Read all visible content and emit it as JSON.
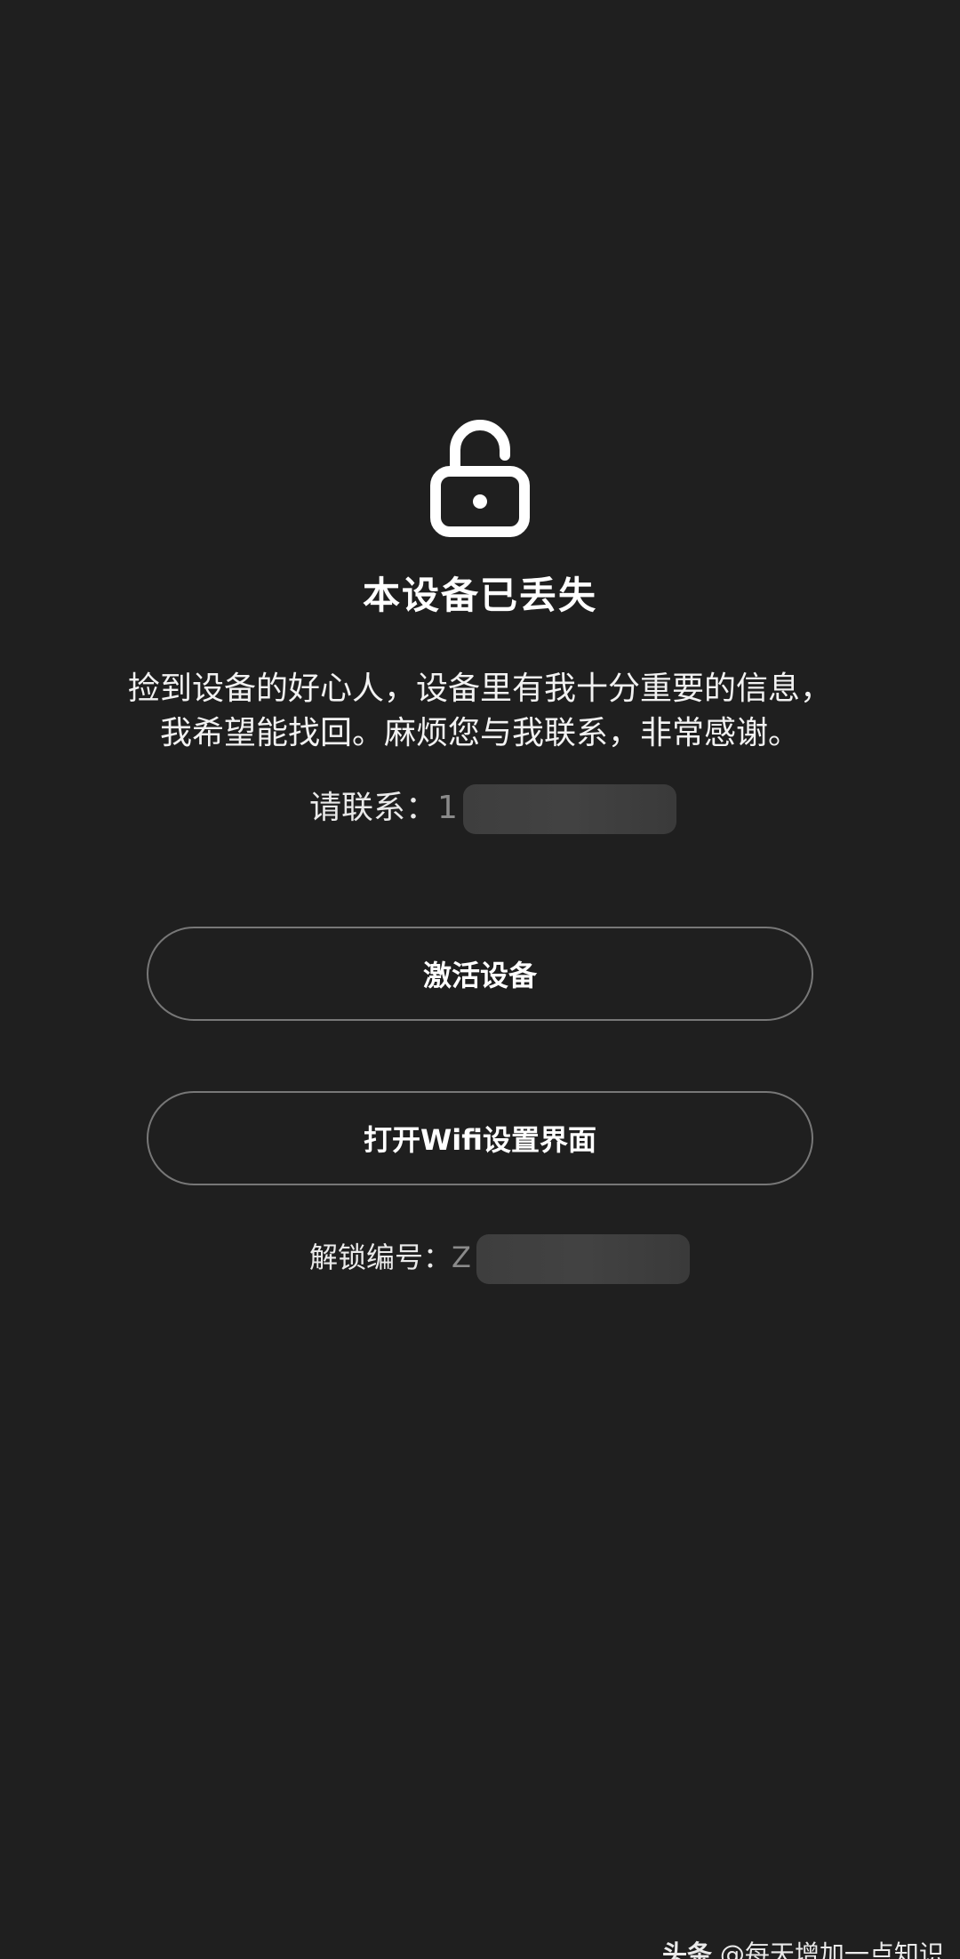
{
  "lost_screen": {
    "icon": "unlocked-padlock-icon",
    "title": "本设备已丢失",
    "message_line1": "捡到设备的好心人，设备里有我十分重要的信息，",
    "message_line2": "我希望能找回。麻烦您与我联系，非常感谢。",
    "contact_label": "请联系：",
    "contact_visible_prefix": "1",
    "buttons": {
      "activate_label": "激活设备",
      "wifi_label": "打开Wifi设置界面"
    },
    "unlock_code_label": "解锁编号：",
    "unlock_code_visible_prefix": "Z"
  },
  "watermark": {
    "brand": "头条",
    "author": "@每天增加一点知识"
  },
  "colors": {
    "background": "#1f1f1f",
    "text": "#ffffff",
    "button_border": "#777777"
  }
}
